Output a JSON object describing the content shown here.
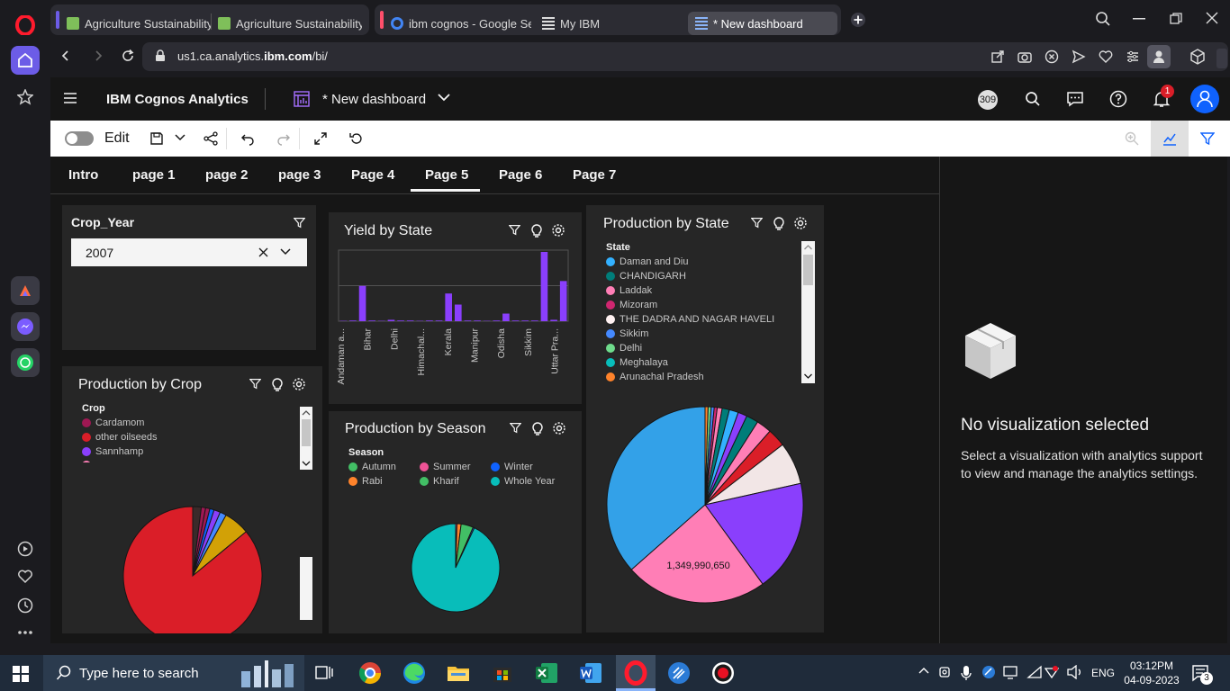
{
  "browser": {
    "tabs": [
      {
        "label": "Agriculture Sustainability"
      },
      {
        "label": "Agriculture Sustainability"
      },
      {
        "label": "ibm cognos - Google Sear"
      },
      {
        "label": "My IBM"
      },
      {
        "label": "* New dashboard"
      }
    ],
    "url_host_prefix": "us1.ca.analytics.",
    "url_host_bold": "ibm.com",
    "url_path": "/bi/"
  },
  "header": {
    "product": "IBM Cognos Analytics",
    "dashboard_title": "* New dashboard",
    "counter": "309",
    "notifications": "1"
  },
  "toolbar": {
    "edit_label": "Edit"
  },
  "page_tabs": [
    "Intro",
    "page 1",
    "page 2",
    "page 3",
    "Page 4",
    "Page 5",
    "Page 6",
    "Page 7"
  ],
  "active_tab": "Page 5",
  "filter_widget": {
    "title": "Crop_Year",
    "value": "2007"
  },
  "yield_widget": {
    "title": "Yield by State"
  },
  "prod_crop_widget": {
    "title": "Production by Crop",
    "legend_title": "Crop",
    "legend": [
      {
        "label": "Cardamom",
        "color": "#9f1853"
      },
      {
        "label": "other oilseeds",
        "color": "#da1e28"
      },
      {
        "label": "Sannhamp",
        "color": "#8a3ffc"
      }
    ]
  },
  "prod_season_widget": {
    "title": "Production by Season",
    "legend_title": "Season",
    "legend": [
      {
        "label": "Autumn",
        "color": "#42be65"
      },
      {
        "label": "Summer",
        "color": "#ee5396"
      },
      {
        "label": "Winter",
        "color": "#0f62fe"
      },
      {
        "label": "Rabi",
        "color": "#ff832b"
      },
      {
        "label": "Kharif",
        "color": "#42be65"
      },
      {
        "label": "Whole Year",
        "color": "#08bdba"
      }
    ]
  },
  "prod_state_widget": {
    "title": "Production by State",
    "legend_title": "State",
    "legend": [
      {
        "label": "Daman and Diu",
        "color": "#33b1ff"
      },
      {
        "label": "CHANDIGARH",
        "color": "#007d79"
      },
      {
        "label": "Laddak",
        "color": "#ff7eb6"
      },
      {
        "label": "Mizoram",
        "color": "#d02670"
      },
      {
        "label": "THE DADRA AND NAGAR HAVELI",
        "color": "#fff1f1"
      },
      {
        "label": "Sikkim",
        "color": "#4589ff"
      },
      {
        "label": "Delhi",
        "color": "#6fdc8c"
      },
      {
        "label": "Meghalaya",
        "color": "#08bdba"
      },
      {
        "label": "Arunachal Pradesh",
        "color": "#ff832b"
      }
    ],
    "data_label": "1,349,990,650"
  },
  "right_panel": {
    "title": "No visualization selected",
    "description": "Select a visualization with analytics support to view and manage the analytics settings."
  },
  "taskbar": {
    "search_placeholder": "Type here to search",
    "language": "ENG",
    "time": "03:12PM",
    "date": "04-09-2023",
    "notifications": "3"
  },
  "chart_data": [
    {
      "type": "bar",
      "title": "Yield by State",
      "categories": [
        "Andaman a...",
        "Bihar",
        "Delhi",
        "Himachal...",
        "Kerala",
        "Manipur",
        "Odisha",
        "Sikkim",
        "Uttar Pra..."
      ],
      "x_tick_labels": [
        "Andaman a...",
        "Bihar",
        "Delhi",
        "Himachal...",
        "Kerala",
        "Manipur",
        "Odisha",
        "Sikkim",
        "Uttar Pra..."
      ],
      "values": [
        0.5,
        1,
        51,
        1,
        0.5,
        2,
        1,
        1,
        0.5,
        1,
        1,
        40,
        24,
        1,
        1,
        0.5,
        1,
        11,
        1,
        1,
        1,
        100,
        2,
        58
      ]
    },
    {
      "type": "pie",
      "title": "Production by Crop",
      "slices": [
        {
          "label": "other oilseeds",
          "value": 86,
          "color": "#da1e28"
        },
        {
          "label": "",
          "value": 6,
          "color": "#d2a106"
        },
        {
          "label": "",
          "value": 1.5,
          "color": "#4589ff"
        },
        {
          "label": "Sannhamp",
          "value": 1.5,
          "color": "#8a3ffc"
        },
        {
          "label": "",
          "value": 1,
          "color": "#0f62fe"
        },
        {
          "label": "",
          "value": 1,
          "color": "#9f1853"
        },
        {
          "label": "Cardamom",
          "value": 1,
          "color": "#9f1853"
        },
        {
          "label": "",
          "value": 2,
          "color": "#3a2a2a"
        }
      ]
    },
    {
      "type": "pie",
      "title": "Production by Season",
      "slices": [
        {
          "label": "Whole Year",
          "value": 93,
          "color": "#08bdba"
        },
        {
          "label": "Kharif",
          "value": 4.5,
          "color": "#42be65"
        },
        {
          "label": "Rabi",
          "value": 1.5,
          "color": "#ff832b"
        },
        {
          "label": "Summer",
          "value": 0.5,
          "color": "#ee5396"
        },
        {
          "label": "Winter",
          "value": 0.5,
          "color": "#0f62fe"
        }
      ]
    },
    {
      "type": "pie",
      "title": "Production by State",
      "slices": [
        {
          "label": "",
          "value": 0.5,
          "color": "#ff832b"
        },
        {
          "label": "",
          "value": 0.5,
          "color": "#6fdc8c"
        },
        {
          "label": "",
          "value": 0.5,
          "color": "#4589ff"
        },
        {
          "label": "",
          "value": 0.5,
          "color": "#d02670"
        },
        {
          "label": "",
          "value": 0.8,
          "color": "#ff7eb6"
        },
        {
          "label": "",
          "value": 1.2,
          "color": "#007d79"
        },
        {
          "label": "",
          "value": 1.5,
          "color": "#33b1ff"
        },
        {
          "label": "",
          "value": 1.5,
          "color": "#8a3ffc"
        },
        {
          "label": "",
          "value": 2,
          "color": "#007d79"
        },
        {
          "label": "",
          "value": 2.5,
          "color": "#ff7eb6"
        },
        {
          "label": "",
          "value": 3,
          "color": "#da1e28"
        },
        {
          "label": "",
          "value": 7,
          "color": "#f2e6e6"
        },
        {
          "label": "",
          "value": 18.5,
          "color": "#8a3ffc"
        },
        {
          "label": "",
          "value": 23.5,
          "color": "#ff7eb6",
          "data_label": "1,349,990,650"
        },
        {
          "label": "",
          "value": 36.5,
          "color": "#33a1e8"
        }
      ]
    }
  ]
}
